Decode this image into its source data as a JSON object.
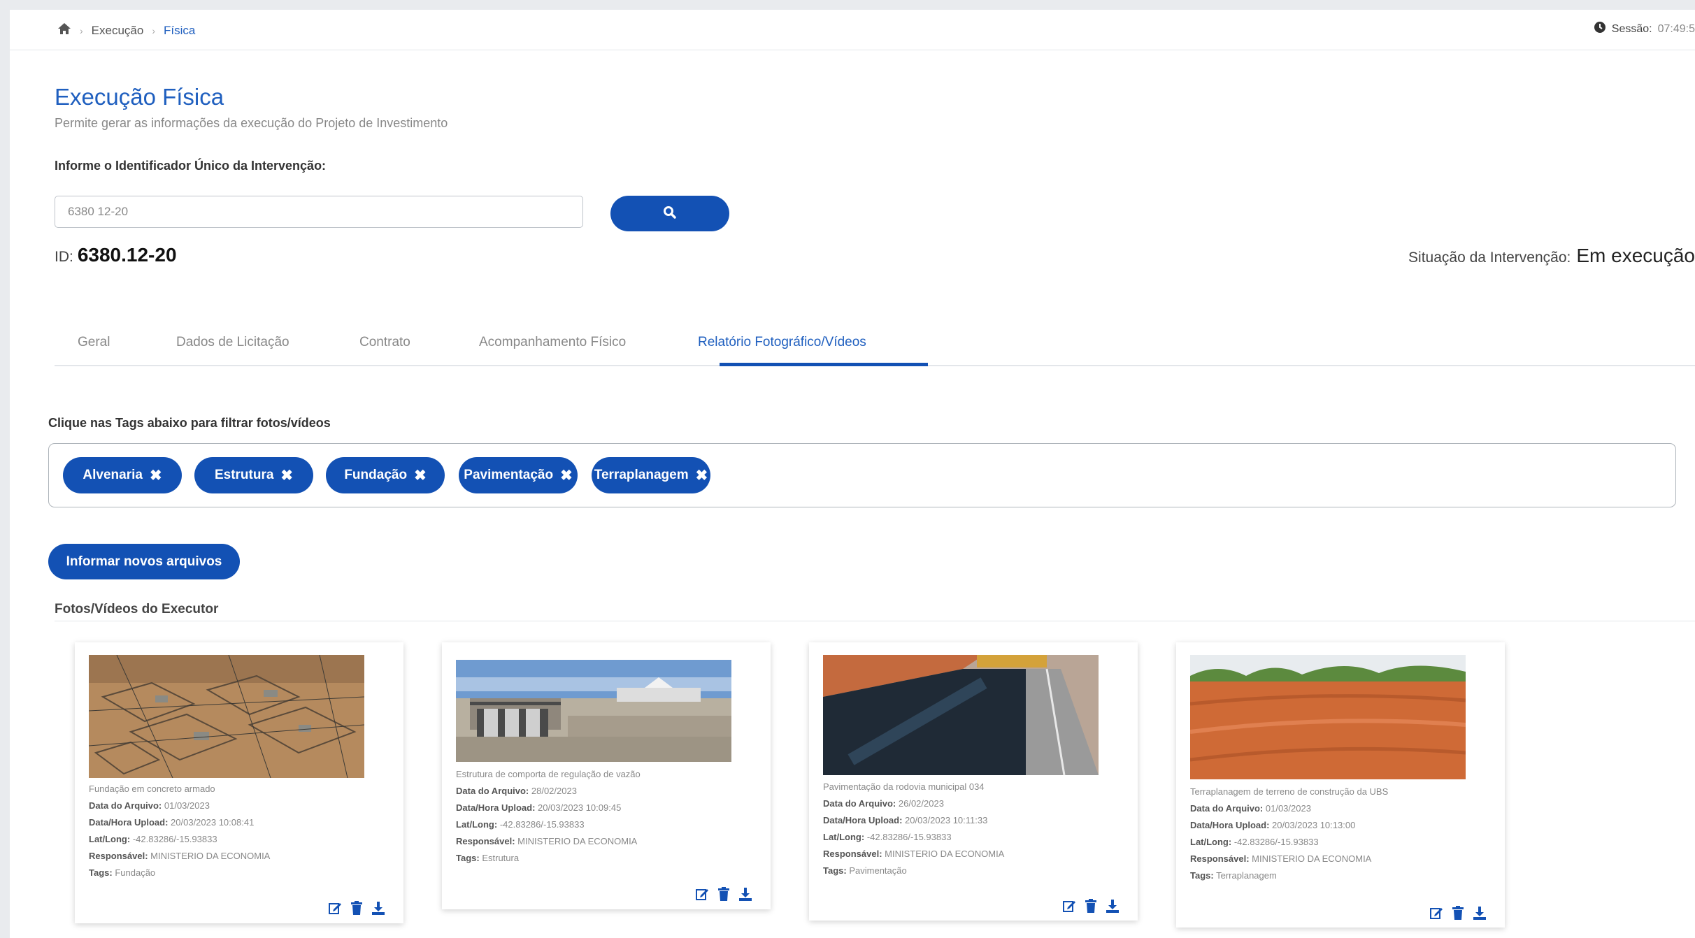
{
  "breadcrumb": {
    "home_icon": "home-icon",
    "items": [
      "Execução",
      "Física"
    ]
  },
  "session": {
    "label": "Sessão:",
    "value": "07:49:5",
    "icon": "clock-icon"
  },
  "page": {
    "title": "Execução Física",
    "subtitle": "Permite gerar as informações da execução do Projeto de Investimento"
  },
  "search": {
    "label": "Informe o Identificador Único da Intervenção:",
    "value": "6380 12-20",
    "button_icon": "search-icon"
  },
  "id_display": {
    "label": "ID:",
    "value": "6380.12-20"
  },
  "situation": {
    "label": "Situação da Intervenção:",
    "value": "Em execução"
  },
  "tabs": [
    {
      "label": "Geral",
      "active": false
    },
    {
      "label": "Dados de Licitação",
      "active": false
    },
    {
      "label": "Contrato",
      "active": false
    },
    {
      "label": "Acompanhamento Físico",
      "active": false
    },
    {
      "label": "Relatório Fotográfico/Vídeos",
      "active": true
    }
  ],
  "filter": {
    "label": "Clique nas Tags abaixo para filtrar fotos/vídeos",
    "tags": [
      "Alvenaria",
      "Estrutura",
      "Fundação",
      "Pavimentação",
      "Terraplanagem"
    ]
  },
  "new_files_button": "Informar novos arquivos",
  "section_title": "Fotos/Vídeos do Executor",
  "card_labels": {
    "date": "Data do Arquivo:",
    "upload": "Data/Hora Upload:",
    "latlong": "Lat/Long:",
    "responsible": "Responsável:",
    "tags": "Tags:"
  },
  "cards": [
    {
      "caption": "Fundação em concreto armado",
      "date": "01/03/2023",
      "upload": "20/03/2023 10:08:41",
      "latlong": "-42.83286/-15.93833",
      "responsible": "MINISTERIO DA ECONOMIA",
      "tags": "Fundação",
      "photo": "construction-foundation-photo"
    },
    {
      "caption": "Estrutura de comporta de regulação de vazão",
      "date": "28/02/2023",
      "upload": "20/03/2023 10:09:45",
      "latlong": "-42.83286/-15.93833",
      "responsible": "MINISTERIO DA ECONOMIA",
      "tags": "Estrutura",
      "photo": "dam-gate-structure-photo"
    },
    {
      "caption": "Pavimentação da rodovia municipal 034",
      "date": "26/02/2023",
      "upload": "20/03/2023 10:11:33",
      "latlong": "-42.83286/-15.93833",
      "responsible": "MINISTERIO DA ECONOMIA",
      "tags": "Pavimentação",
      "photo": "road-paving-photo"
    },
    {
      "caption": "Terraplanagem de terreno de construção da UBS",
      "date": "01/03/2023",
      "upload": "20/03/2023 10:13:00",
      "latlong": "-42.83286/-15.93833",
      "responsible": "MINISTERIO DA ECONOMIA",
      "tags": "Terraplanagem",
      "photo": "earthwork-terrain-photo"
    }
  ],
  "colors": {
    "primary": "#1351b4",
    "title_blue": "#1f5fbf"
  }
}
